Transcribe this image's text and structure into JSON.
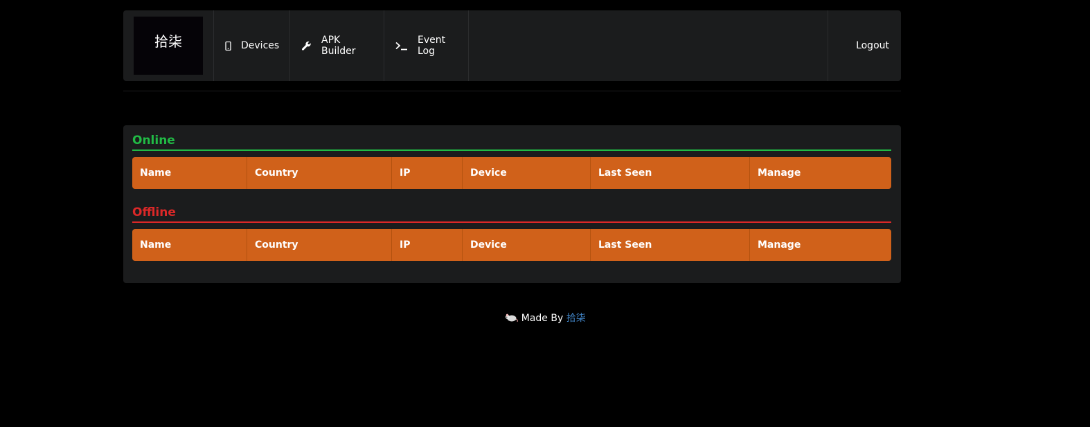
{
  "nav": {
    "logo_text": "拾柒",
    "items": [
      {
        "label": "Devices",
        "icon": "mobile-icon"
      },
      {
        "label": "APK Builder",
        "icon": "wrench-icon"
      },
      {
        "label": "Event Log",
        "icon": "terminal-icon"
      }
    ],
    "logout_label": "Logout"
  },
  "sections": {
    "online": {
      "title": "Online",
      "color": "#21ba45"
    },
    "offline": {
      "title": "Offline",
      "color": "#db2828"
    }
  },
  "table": {
    "columns": [
      "Name",
      "Country",
      "IP",
      "Device",
      "Last Seen",
      "Manage"
    ],
    "header_color": "#d0611a"
  },
  "footer": {
    "icon": "rat-icon",
    "prefix": "Made By",
    "link_text": "拾柒"
  }
}
